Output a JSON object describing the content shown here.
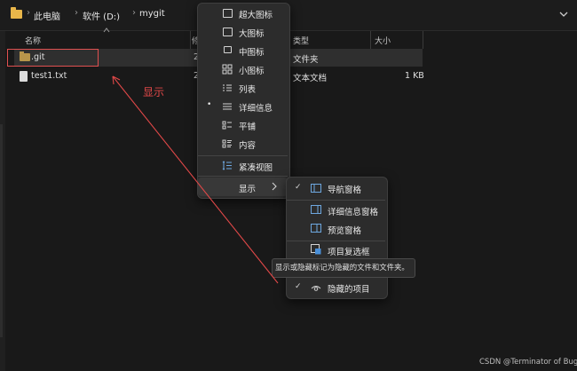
{
  "breadcrumb": {
    "items": [
      "此电脑",
      "软件 (D:)",
      "mygit"
    ]
  },
  "columns": {
    "name": "名称",
    "date": "修",
    "type": "类型",
    "size": "大小"
  },
  "files": [
    {
      "name": ".git",
      "date": "2",
      "type": "文件夹",
      "size": ""
    },
    {
      "name": "test1.txt",
      "date": "2",
      "type": "文本文档",
      "size": "1 KB"
    }
  ],
  "annotation": "显示",
  "view_menu": {
    "items": [
      "超大图标",
      "大图标",
      "中图标",
      "小图标",
      "列表",
      "详细信息",
      "平铺",
      "内容",
      "紧凑视图",
      "显示"
    ],
    "selected": "详细信息"
  },
  "show_menu": {
    "items": [
      {
        "label": "导航窗格",
        "checked": true
      },
      {
        "label": "详细信息窗格",
        "checked": false
      },
      {
        "label": "预览窗格",
        "checked": false
      },
      {
        "label": "项目复选框",
        "checked": false
      },
      {
        "label": "隐藏的项目",
        "checked": true
      }
    ]
  },
  "tooltip": "显示或隐藏标记为隐藏的文件和文件夹。",
  "watermark": "CSDN @Terminator of Bug",
  "colors": {
    "highlight_box": "#e05050",
    "annotation": "#e04848",
    "menu_bg": "#2c2c2c",
    "folder": "#e9b64a"
  }
}
